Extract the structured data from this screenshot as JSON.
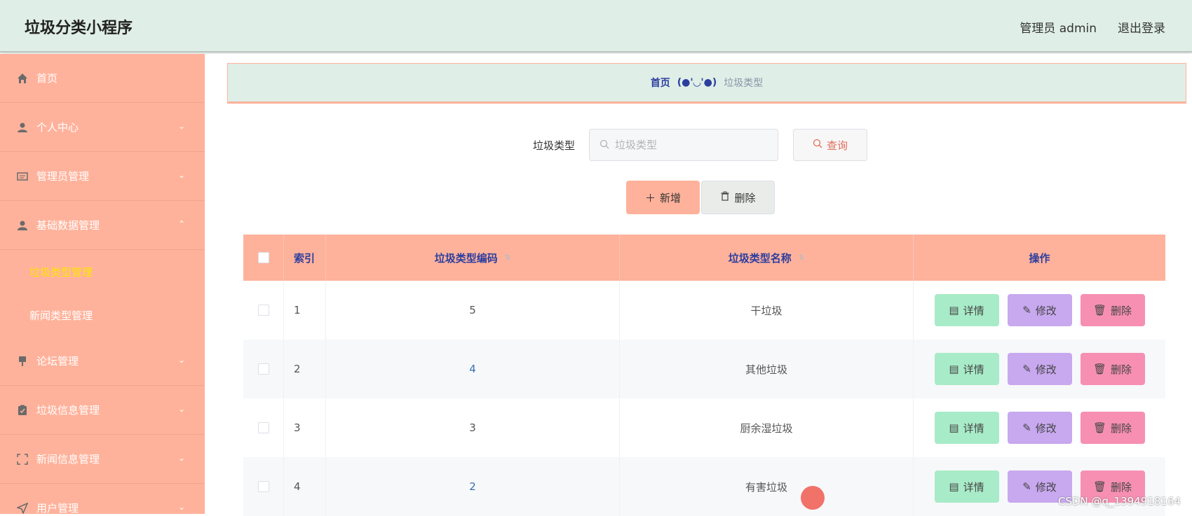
{
  "header": {
    "title": "垃圾分类小程序",
    "user": "管理员 admin",
    "logout": "退出登录"
  },
  "sidebar": {
    "items": [
      {
        "label": "首页",
        "icon": "home-icon"
      },
      {
        "label": "个人中心",
        "icon": "user-icon"
      },
      {
        "label": "管理员管理",
        "icon": "card-icon"
      },
      {
        "label": "基础数据管理",
        "icon": "users-icon"
      },
      {
        "label": "论坛管理",
        "icon": "pin-icon"
      },
      {
        "label": "垃圾信息管理",
        "icon": "clipboard-icon"
      },
      {
        "label": "新闻信息管理",
        "icon": "frame-icon"
      },
      {
        "label": "用户管理",
        "icon": "send-icon"
      }
    ],
    "sub_items": [
      {
        "label": "垃圾类型管理",
        "active": true
      },
      {
        "label": "新闻类型管理",
        "active": false
      }
    ]
  },
  "breadcrumb": {
    "home": "首页",
    "face": "(●'◡'●)",
    "current": "垃圾类型"
  },
  "search": {
    "label": "垃圾类型",
    "placeholder": "垃圾类型",
    "button": "查询"
  },
  "actions": {
    "add": "新增",
    "delete": "删除"
  },
  "table": {
    "headers": {
      "index": "索引",
      "code": "垃圾类型编码",
      "name": "垃圾类型名称",
      "ops": "操作"
    },
    "rows": [
      {
        "index": "1",
        "code": "5",
        "name": "干垃圾"
      },
      {
        "index": "2",
        "code": "4",
        "name": "其他垃圾"
      },
      {
        "index": "3",
        "code": "3",
        "name": "厨余湿垃圾"
      },
      {
        "index": "4",
        "code": "2",
        "name": "有害垃圾"
      }
    ],
    "row_buttons": {
      "detail": "详情",
      "edit": "修改",
      "remove": "删除"
    }
  },
  "watermark": "CSDN @q_1394918164",
  "colors": {
    "accent": "#ffb29b",
    "header_bg": "#dfeee7",
    "detail": "#a8ebc8",
    "edit": "#c8a8ef",
    "remove": "#f78fb3",
    "active_sub": "#ffe600"
  }
}
